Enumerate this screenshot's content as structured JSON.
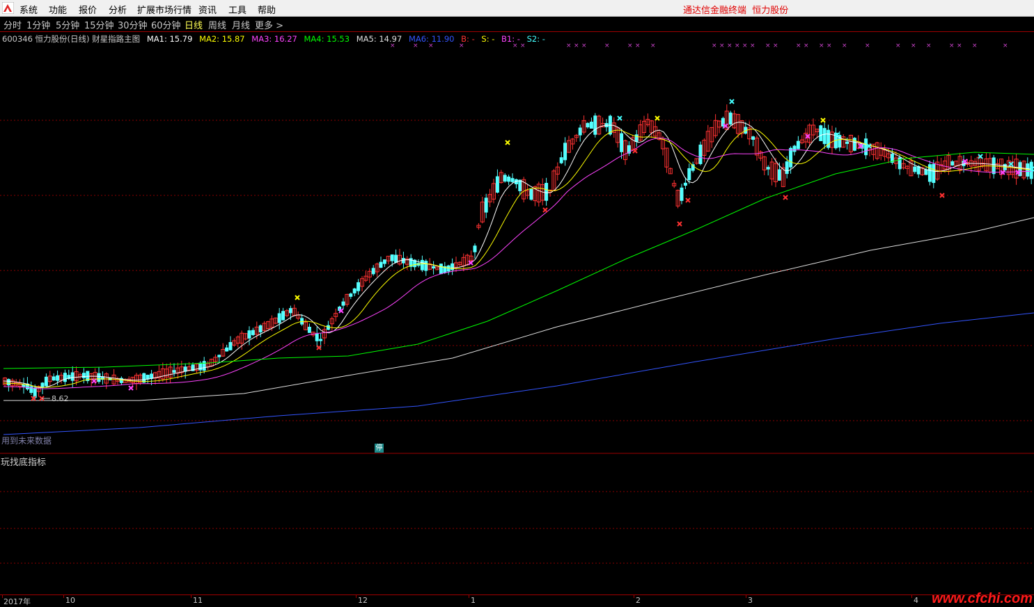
{
  "menu": {
    "items": [
      "系统",
      "功能",
      "报价",
      "分析",
      "扩展市场行情",
      "资讯",
      "工具",
      "帮助"
    ],
    "brand_left": "通达信金融终端",
    "brand_right": "恒力股份"
  },
  "periods": {
    "items": [
      "分时",
      "1分钟",
      "5分钟",
      "15分钟",
      "30分钟",
      "60分钟",
      "日线",
      "周线",
      "月线"
    ],
    "active": "日线",
    "more_label": "更多 >"
  },
  "legend": {
    "stock": "600346 恒力股份(日线) 财星指路主图",
    "ma": [
      {
        "label": "MA1: 15.79",
        "color": "#ffffff"
      },
      {
        "label": "MA2: 15.87",
        "color": "#ffff00"
      },
      {
        "label": "MA3: 16.27",
        "color": "#ff44ff"
      },
      {
        "label": "MA4: 15.53",
        "color": "#00ff00"
      },
      {
        "label": "MA5: 14.97",
        "color": "#e0e0e0"
      },
      {
        "label": "MA6: 11.90",
        "color": "#3355ff"
      },
      {
        "label": "B: -",
        "color": "#ff3333"
      },
      {
        "label": "S: -",
        "color": "#ffff00"
      },
      {
        "label": "B1: -",
        "color": "#ff44ff"
      },
      {
        "label": "S2: -",
        "color": "#44ffff"
      }
    ]
  },
  "chart": {
    "low_label": "8.62",
    "future_note": "用到未来数据",
    "stop_badge": "停",
    "subchart_title": "玩找底指标"
  },
  "time_axis": [
    "2017年",
    "10",
    "11",
    "12",
    "1",
    "2",
    "3",
    "4"
  ],
  "watermark": "www.cfchi.com",
  "colors": {
    "up": "#ff3232",
    "down": "#54ffff",
    "ma1": "#ffffff",
    "ma2": "#ffff00",
    "ma3": "#ff44ff",
    "ma4": "#00ff00",
    "ma5": "#e0e0e0",
    "ma6": "#3355ff",
    "grid": "#8b0000"
  }
}
